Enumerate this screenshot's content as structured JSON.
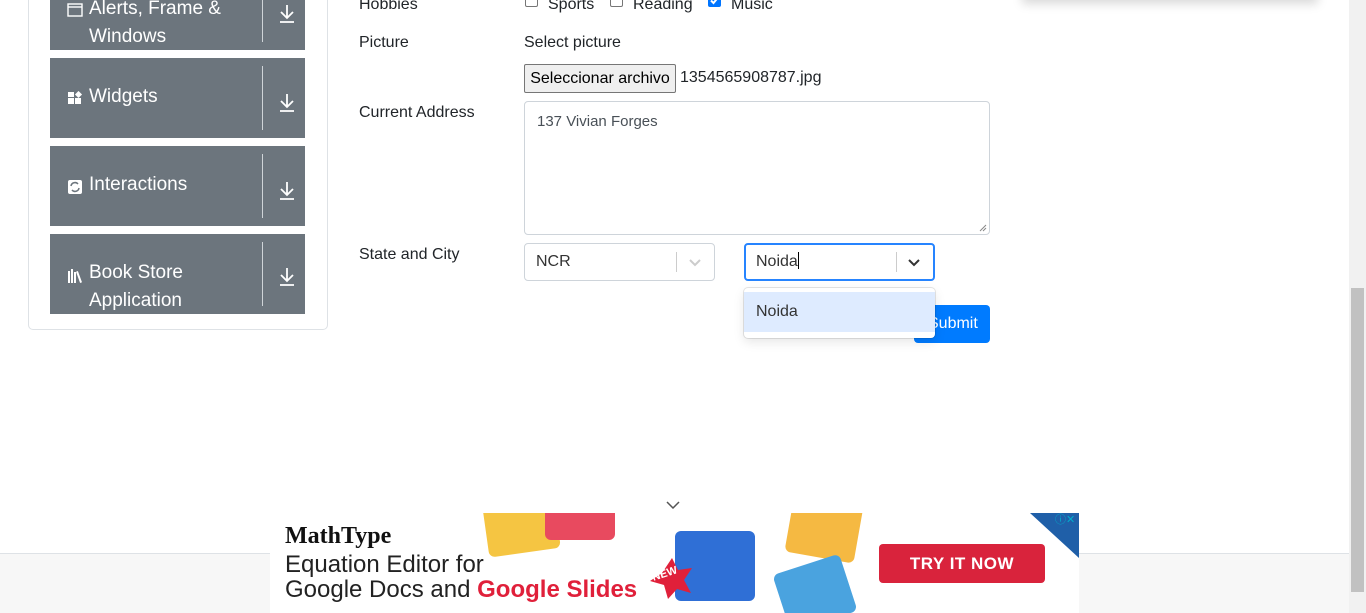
{
  "sidebar": {
    "groups": [
      {
        "label": "Alerts, Frame & Windows",
        "icon": "window-icon"
      },
      {
        "label": "Widgets",
        "icon": "widgets-icon"
      },
      {
        "label": "Interactions",
        "icon": "interactions-icon"
      },
      {
        "label": "Book Store Application",
        "icon": "books-icon"
      }
    ]
  },
  "form": {
    "hobbies_label": "Hobbies",
    "hobbies": [
      {
        "label": "Sports",
        "checked": false
      },
      {
        "label": "Reading",
        "checked": false
      },
      {
        "label": "Music",
        "checked": true
      }
    ],
    "picture_label": "Picture",
    "select_picture": "Select picture",
    "file_button": "Seleccionar archivo",
    "file_name": "1354565908787.jpg",
    "address_label": "Current Address",
    "address_value": "137 Vivian Forges",
    "state_city_label": "State and City",
    "state_value": "NCR",
    "city_value": "Noida",
    "city_options": [
      "Noida"
    ],
    "submit_label": "Submit"
  },
  "ad": {
    "brand": "MathType",
    "line1": "Equation Editor for",
    "line2_plain": "Google Docs and",
    "line2_highlight": "Google Slides",
    "badge": "NEW",
    "cta": "TRY IT NOW"
  },
  "colors": {
    "sidebar_bg": "#6c757d",
    "primary": "#007bff",
    "focus_border": "#2684ff",
    "option_highlight": "#deebff",
    "ad_red": "#d9233c"
  }
}
